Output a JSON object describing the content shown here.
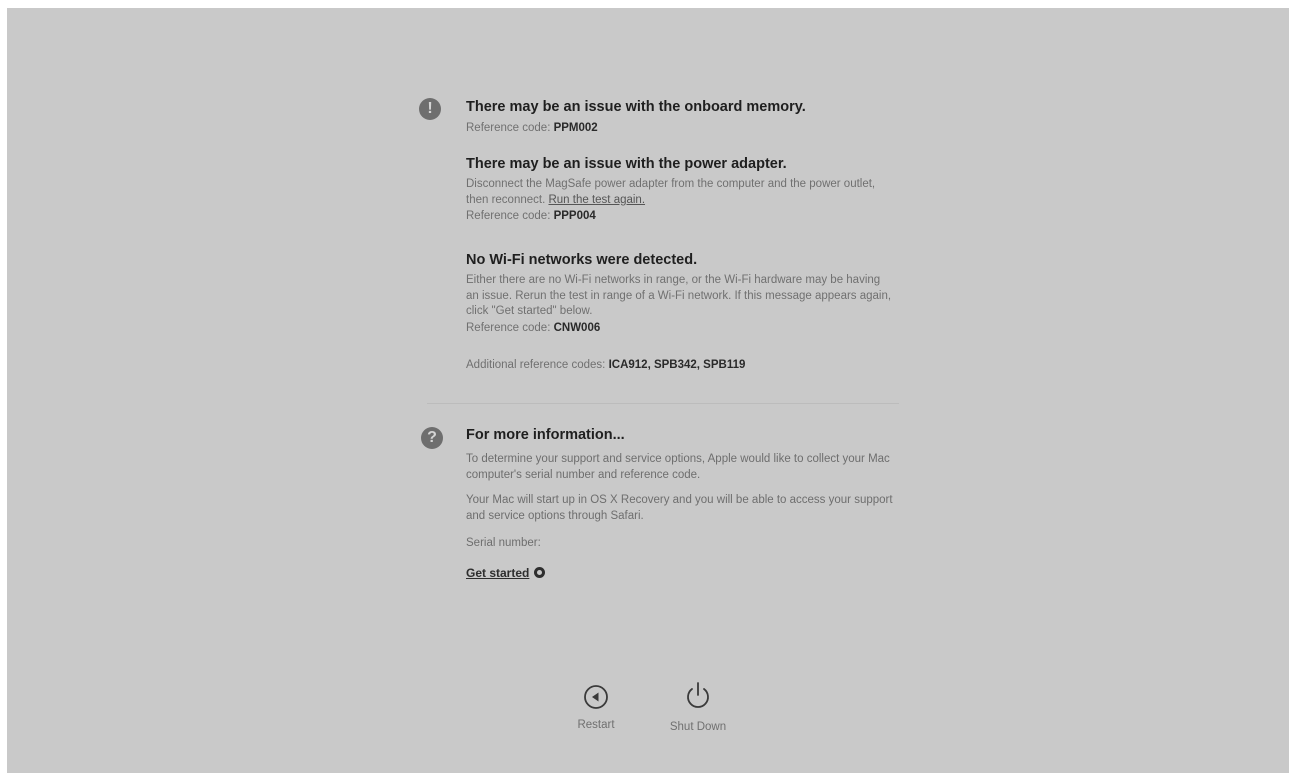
{
  "issues": [
    {
      "title": "There may be an issue with the onboard memory.",
      "ref_label": "Reference code:",
      "ref_code": "PPM002"
    },
    {
      "title": "There may be an issue with the power adapter.",
      "desc_before_link": "Disconnect the MagSafe power adapter from the computer and the power outlet, then reconnect.",
      "link": "Run the test again.",
      "ref_label": "Reference code:",
      "ref_code": "PPP004"
    },
    {
      "title": "No Wi-Fi networks were detected.",
      "desc": "Either there are no Wi-Fi networks in range, or the Wi-Fi hardware may be having an issue. Rerun the test in range of a Wi-Fi network. If this message appears again, click \"Get started\" below.",
      "ref_label": "Reference code:",
      "ref_code": "CNW006"
    }
  ],
  "additional": {
    "label": "Additional reference codes:",
    "codes": "ICA912, SPB342, SPB119"
  },
  "info": {
    "title": "For more information...",
    "para1": "To determine your support and service options, Apple would like to collect your Mac computer's serial number and reference code.",
    "para2": "Your Mac will start up in OS X Recovery and you will be able to access your support and service options through Safari.",
    "serial_label": "Serial number:",
    "get_started": "Get started"
  },
  "icons": {
    "warning": "exclamation-circle-icon",
    "help": "question-circle-icon",
    "restart": "restart-icon",
    "power": "power-icon"
  },
  "buttons": {
    "restart": "Restart",
    "shutdown": "Shut Down"
  }
}
